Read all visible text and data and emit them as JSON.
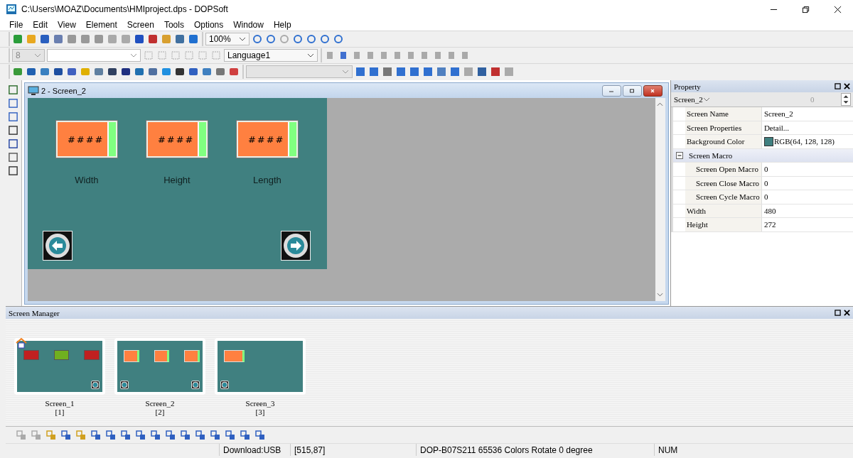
{
  "window": {
    "title": "C:\\Users\\MOAZ\\Documents\\HMIproject.dps - DOPSoft"
  },
  "menu": [
    "File",
    "Edit",
    "View",
    "Element",
    "Screen",
    "Tools",
    "Options",
    "Window",
    "Help"
  ],
  "toolbar": {
    "zoom": "100%",
    "font_size": "8",
    "language": "Language1"
  },
  "document": {
    "title": "2 - Screen_2",
    "displays": [
      {
        "value": "####",
        "label": "Width"
      },
      {
        "value": "####",
        "label": "Height"
      },
      {
        "value": "####",
        "label": "Length"
      }
    ]
  },
  "property": {
    "title": "Property",
    "object": "Screen_2",
    "index": "0",
    "rows": [
      {
        "kind": "text",
        "name": "Screen Name",
        "value": "Screen_2"
      },
      {
        "kind": "text",
        "name": "Screen Properties",
        "value": "Detail..."
      },
      {
        "kind": "color",
        "name": "Background Color",
        "value": "RGB(64, 128, 128)",
        "color": "#408080"
      },
      {
        "kind": "group",
        "name": "Screen Macro",
        "expanded": true,
        "children": [
          {
            "kind": "text",
            "name": "Screen Open Macro",
            "value": "0"
          },
          {
            "kind": "text",
            "name": "Screen Close Macro",
            "value": "0"
          },
          {
            "kind": "text",
            "name": "Screen Cycle Macro",
            "value": "0"
          }
        ]
      },
      {
        "kind": "text",
        "name": "Width",
        "value": "480"
      },
      {
        "kind": "text",
        "name": "Height",
        "value": "272"
      }
    ]
  },
  "screen_manager": {
    "title": "Screen Manager",
    "screens": [
      {
        "name": "Screen_1",
        "number": "[1]",
        "home": true,
        "widgets": [
          {
            "kind": "lamp",
            "color": "#c02020"
          },
          {
            "kind": "lamp",
            "color": "#70b020"
          },
          {
            "kind": "lamp",
            "color": "#c02020"
          }
        ],
        "nav": [
          {
            "kind": "spacer"
          },
          {
            "kind": "nav"
          }
        ]
      },
      {
        "name": "Screen_2",
        "number": "[2]",
        "home": false,
        "widgets": [
          {
            "kind": "display"
          },
          {
            "kind": "display"
          },
          {
            "kind": "display"
          }
        ],
        "nav": [
          {
            "kind": "nav"
          },
          {
            "kind": "nav"
          }
        ]
      },
      {
        "name": "Screen_3",
        "number": "[3]",
        "home": false,
        "widgets": [
          {
            "kind": "display"
          }
        ],
        "nav": [
          {
            "kind": "nav"
          }
        ]
      }
    ]
  },
  "status_bar": [
    "Download:USB",
    "[515,87]",
    "DOP-B07S211 65536 Colors Rotate 0 degree",
    "NUM"
  ]
}
